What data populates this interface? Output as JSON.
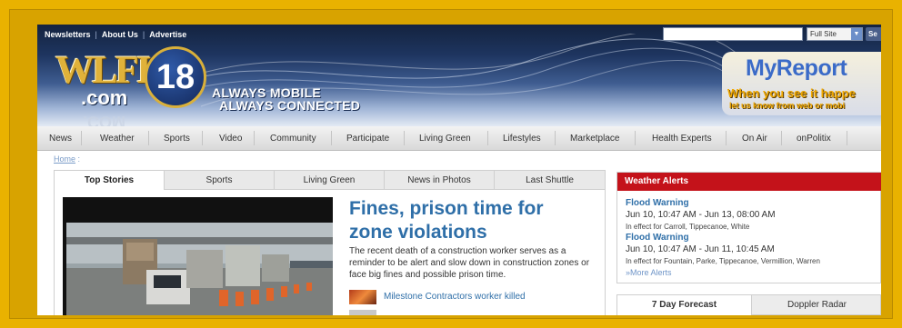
{
  "toplinks": [
    "Newsletters",
    "About Us",
    "Advertise"
  ],
  "search": {
    "placeholder": "",
    "scope": "Full Site",
    "button": "Se"
  },
  "logo": {
    "wordmark": "WLFI",
    "domain": ".com",
    "channel": "18"
  },
  "tagline": {
    "line1": "ALWAYS MOBILE",
    "line2": "ALWAYS CONNECTED"
  },
  "myreport": {
    "title": "MyReport",
    "tagline": "When you see it happe",
    "sub": "let us know from web or mobi"
  },
  "nav": [
    "News",
    "Weather",
    "Sports",
    "Video",
    "Community",
    "Participate",
    "Living Green",
    "Lifestyles",
    "Marketplace",
    "Health Experts",
    "On Air",
    "onPolitix"
  ],
  "breadcrumb": {
    "home": "Home",
    "sep": ":"
  },
  "story_tabs": [
    "Top Stories",
    "Sports",
    "Living Green",
    "News in Photos",
    "Last Shuttle"
  ],
  "story": {
    "headline": "Fines, prison time for zone violations",
    "summary": "The recent death of a construction worker serves as a reminder to be alert and slow down in construction zones or face big fines and possible prison time.",
    "related": "Milestone Contractors worker killed"
  },
  "weather": {
    "title": "Weather Alerts",
    "alerts": [
      {
        "title": "Flood Warning",
        "time": "Jun 10, 10:47 AM - Jun 13, 08:00 AM",
        "area": "In effect for Carroll, Tippecanoe, White"
      },
      {
        "title": "Flood Warning",
        "time": "Jun 10, 10:47 AM - Jun 11, 10:45 AM",
        "area": "In effect for Fountain, Parke, Tippecanoe, Vermillion, Warren"
      }
    ],
    "more": "»More Alerts"
  },
  "forecast_tabs": [
    "7 Day Forecast",
    "Doppler Radar"
  ],
  "colors": {
    "frame": "#e9b200",
    "link": "#2f6fa8",
    "alert_header": "#c4121a"
  }
}
